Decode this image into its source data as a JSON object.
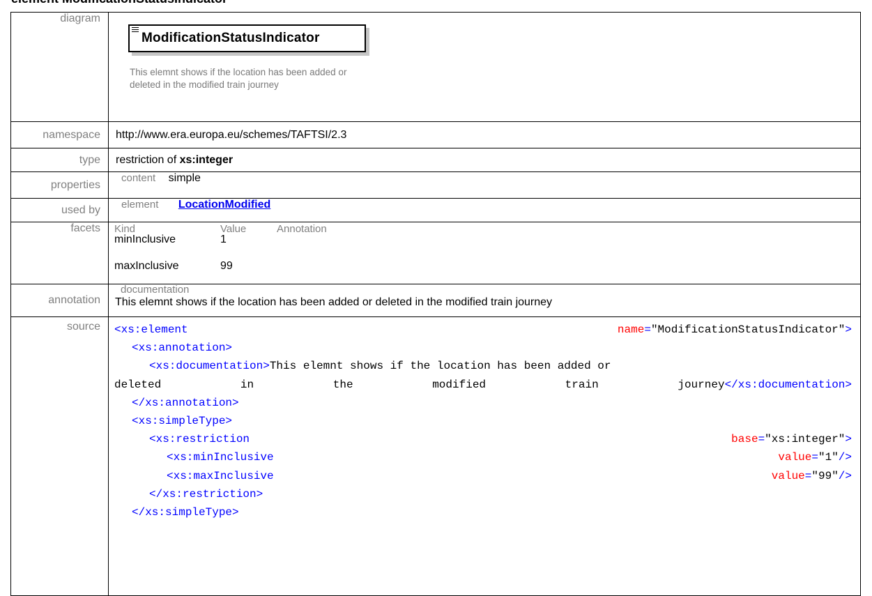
{
  "heading": "element ModificationStatusIndicator",
  "labels": {
    "diagram": "diagram",
    "namespace": "namespace",
    "type": "type",
    "properties": "properties",
    "used_by": "used by",
    "facets": "facets",
    "annotation": "annotation",
    "source": "source"
  },
  "diagram": {
    "element_name": "ModificationStatusIndicator",
    "description": "This elemnt shows if the location has been added or deleted in the modified train journey"
  },
  "namespace": "http://www.era.europa.eu/schemes/TAFTSI/2.3",
  "type": {
    "prefix": "restriction of ",
    "base": "xs:integer"
  },
  "properties": {
    "key": "content",
    "value": "simple"
  },
  "used_by": {
    "key": "element",
    "link": "LocationModified"
  },
  "facets": {
    "headers": [
      "Kind",
      "Value",
      "Annotation"
    ],
    "rows": [
      {
        "kind": "minInclusive",
        "value": "1"
      },
      {
        "kind": "maxInclusive",
        "value": "99"
      }
    ]
  },
  "annotation": {
    "key": "documentation",
    "text": "This elemnt shows if the location has been added or deleted in the modified train journey"
  },
  "source": {
    "l1_tag": "<xs:element",
    "l1_attr": "name",
    "l1_val": "\"ModificationStatusIndicator\"",
    "l1_end": ">",
    "l2": "<xs:annotation>",
    "l3_open": "<xs:documentation>",
    "doc_line1": "This elemnt shows if the location has been added or",
    "doc_w1": "deleted",
    "doc_w2": "in",
    "doc_w3": "the",
    "doc_w4": "modified",
    "doc_w5": "train",
    "doc_w6": "journey",
    "l3_close": "</xs:documentation>",
    "l5": "</xs:annotation>",
    "l6": "<xs:simpleType>",
    "l7_tag": "<xs:restriction",
    "l7_attr": "base",
    "l7_val": "\"xs:integer\"",
    "l7_end": ">",
    "l8_tag": "<xs:minInclusive",
    "l8_attr": "value",
    "l8_val": "\"1\"",
    "l8_end": "/>",
    "l9_tag": "<xs:maxInclusive",
    "l9_attr": "value",
    "l9_val": "\"99\"",
    "l9_end": "/>",
    "l10": "</xs:restriction>",
    "l11": "</xs:simpleType>",
    "eq": "="
  }
}
